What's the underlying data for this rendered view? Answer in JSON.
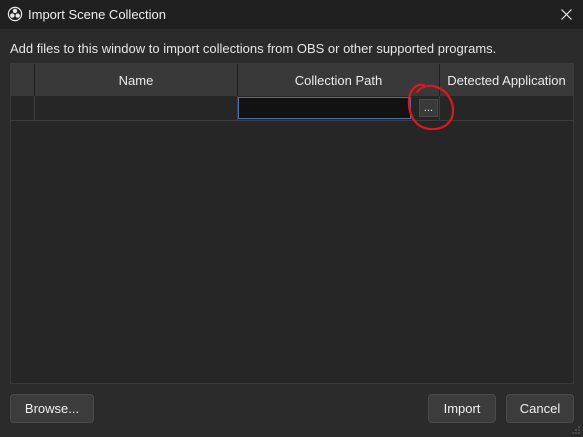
{
  "window": {
    "title": "Import Scene Collection",
    "app_icon": "obs-logo-icon",
    "close_icon": "close-icon"
  },
  "description": "Add files to this window to import collections from OBS or other supported programs.",
  "table": {
    "columns": [
      "",
      "Name",
      "Collection Path",
      "Detected Application"
    ],
    "rows": [
      {
        "name": "",
        "collection_path": "",
        "detected_application": ""
      }
    ],
    "browse_path_button_label": "...",
    "edit_border_color": "#4e6ea8"
  },
  "annotation": {
    "color": "#d9181f",
    "shape": "hand-drawn circle around path browse button"
  },
  "buttons": {
    "browse": "Browse...",
    "import": "Import",
    "cancel": "Cancel"
  }
}
